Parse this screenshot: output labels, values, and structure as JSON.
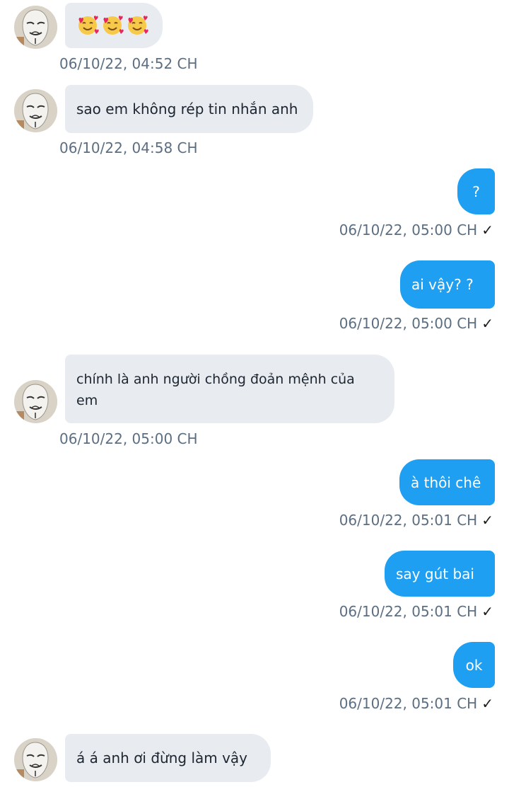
{
  "messages": [
    {
      "direction": "in",
      "emoji": [
        "smiling-face-with-hearts-icon",
        "smiling-face-with-hearts-icon",
        "smiling-face-with-hearts-icon"
      ],
      "timestamp": "06/10/22,  04:52 CH"
    },
    {
      "direction": "in",
      "text": "sao em không rép tin nhắn anh",
      "timestamp": "06/10/22,  04:58 CH"
    },
    {
      "direction": "out",
      "text": "?",
      "timestamp": "06/10/22,  05:00 CH",
      "status": "✓"
    },
    {
      "direction": "out",
      "text": "ai vậy? ?",
      "timestamp": "06/10/22,  05:00 CH",
      "status": "✓"
    },
    {
      "direction": "in",
      "text_line1": "chính là anh người chồng đoản mệnh của",
      "text_line2": "em",
      "timestamp": "06/10/22,  05:00 CH"
    },
    {
      "direction": "out",
      "text": "à thôi chê",
      "timestamp": "06/10/22,  05:01 CH",
      "status": "✓"
    },
    {
      "direction": "out",
      "text": "say gút bai",
      "timestamp": "06/10/22,  05:01 CH",
      "status": "✓"
    },
    {
      "direction": "out",
      "text": "ok",
      "timestamp": "06/10/22,  05:01 CH",
      "status": "✓"
    },
    {
      "direction": "in",
      "text": "á á anh ơi đừng làm vậy"
    }
  ],
  "colors": {
    "outgoing_bubble": "#1e9ff2",
    "incoming_bubble": "#e8ecf0",
    "timestamp": "#5b6e82"
  }
}
